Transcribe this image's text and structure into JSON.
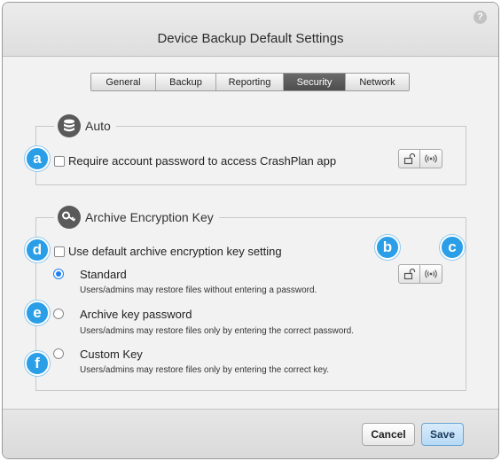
{
  "dialog": {
    "title": "Device Backup Default Settings",
    "help_glyph": "?"
  },
  "tabs": [
    {
      "label": "General",
      "active": false
    },
    {
      "label": "Backup",
      "active": false
    },
    {
      "label": "Reporting",
      "active": false
    },
    {
      "label": "Security",
      "active": true
    },
    {
      "label": "Network",
      "active": false
    }
  ],
  "auto_section": {
    "title": "Auto",
    "icon": "database-icon",
    "require_password_label": "Require account password to access CrashPlan app",
    "require_password_checked": false
  },
  "encryption_section": {
    "title": "Archive Encryption Key",
    "icon": "key-icon",
    "use_default_label": "Use default archive encryption key setting",
    "use_default_checked": false,
    "options": [
      {
        "label": "Standard",
        "description": "Users/admins may restore files without entering a password.",
        "selected": true
      },
      {
        "label": "Archive key password",
        "description": "Users/admins may restore files only by entering the correct password.",
        "selected": false
      },
      {
        "label": "Custom Key",
        "description": "Users/admins may restore files only by entering the correct key.",
        "selected": false
      }
    ]
  },
  "callouts": {
    "a": "a",
    "b": "b",
    "c": "c",
    "d": "d",
    "e": "e",
    "f": "f"
  },
  "footer": {
    "cancel_label": "Cancel",
    "save_label": "Save"
  },
  "colors": {
    "accent": "#1d7ff0",
    "callout": "#2a9ee6",
    "active_tab": "#555555"
  }
}
